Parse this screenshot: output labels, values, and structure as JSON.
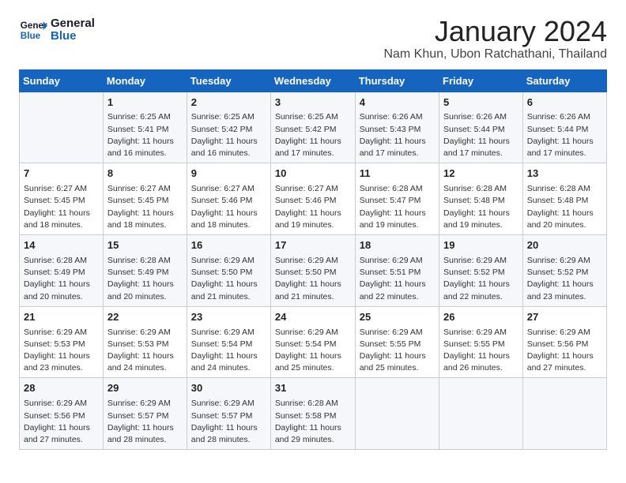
{
  "header": {
    "logo_general": "General",
    "logo_blue": "Blue",
    "month": "January 2024",
    "location": "Nam Khun, Ubon Ratchathani, Thailand"
  },
  "days_of_week": [
    "Sunday",
    "Monday",
    "Tuesday",
    "Wednesday",
    "Thursday",
    "Friday",
    "Saturday"
  ],
  "weeks": [
    [
      {
        "day": "",
        "sunrise": "",
        "sunset": "",
        "daylight": ""
      },
      {
        "day": "1",
        "sunrise": "Sunrise: 6:25 AM",
        "sunset": "Sunset: 5:41 PM",
        "daylight": "Daylight: 11 hours and 16 minutes."
      },
      {
        "day": "2",
        "sunrise": "Sunrise: 6:25 AM",
        "sunset": "Sunset: 5:42 PM",
        "daylight": "Daylight: 11 hours and 16 minutes."
      },
      {
        "day": "3",
        "sunrise": "Sunrise: 6:25 AM",
        "sunset": "Sunset: 5:42 PM",
        "daylight": "Daylight: 11 hours and 17 minutes."
      },
      {
        "day": "4",
        "sunrise": "Sunrise: 6:26 AM",
        "sunset": "Sunset: 5:43 PM",
        "daylight": "Daylight: 11 hours and 17 minutes."
      },
      {
        "day": "5",
        "sunrise": "Sunrise: 6:26 AM",
        "sunset": "Sunset: 5:44 PM",
        "daylight": "Daylight: 11 hours and 17 minutes."
      },
      {
        "day": "6",
        "sunrise": "Sunrise: 6:26 AM",
        "sunset": "Sunset: 5:44 PM",
        "daylight": "Daylight: 11 hours and 17 minutes."
      }
    ],
    [
      {
        "day": "7",
        "sunrise": "Sunrise: 6:27 AM",
        "sunset": "Sunset: 5:45 PM",
        "daylight": "Daylight: 11 hours and 18 minutes."
      },
      {
        "day": "8",
        "sunrise": "Sunrise: 6:27 AM",
        "sunset": "Sunset: 5:45 PM",
        "daylight": "Daylight: 11 hours and 18 minutes."
      },
      {
        "day": "9",
        "sunrise": "Sunrise: 6:27 AM",
        "sunset": "Sunset: 5:46 PM",
        "daylight": "Daylight: 11 hours and 18 minutes."
      },
      {
        "day": "10",
        "sunrise": "Sunrise: 6:27 AM",
        "sunset": "Sunset: 5:46 PM",
        "daylight": "Daylight: 11 hours and 19 minutes."
      },
      {
        "day": "11",
        "sunrise": "Sunrise: 6:28 AM",
        "sunset": "Sunset: 5:47 PM",
        "daylight": "Daylight: 11 hours and 19 minutes."
      },
      {
        "day": "12",
        "sunrise": "Sunrise: 6:28 AM",
        "sunset": "Sunset: 5:48 PM",
        "daylight": "Daylight: 11 hours and 19 minutes."
      },
      {
        "day": "13",
        "sunrise": "Sunrise: 6:28 AM",
        "sunset": "Sunset: 5:48 PM",
        "daylight": "Daylight: 11 hours and 20 minutes."
      }
    ],
    [
      {
        "day": "14",
        "sunrise": "Sunrise: 6:28 AM",
        "sunset": "Sunset: 5:49 PM",
        "daylight": "Daylight: 11 hours and 20 minutes."
      },
      {
        "day": "15",
        "sunrise": "Sunrise: 6:28 AM",
        "sunset": "Sunset: 5:49 PM",
        "daylight": "Daylight: 11 hours and 20 minutes."
      },
      {
        "day": "16",
        "sunrise": "Sunrise: 6:29 AM",
        "sunset": "Sunset: 5:50 PM",
        "daylight": "Daylight: 11 hours and 21 minutes."
      },
      {
        "day": "17",
        "sunrise": "Sunrise: 6:29 AM",
        "sunset": "Sunset: 5:50 PM",
        "daylight": "Daylight: 11 hours and 21 minutes."
      },
      {
        "day": "18",
        "sunrise": "Sunrise: 6:29 AM",
        "sunset": "Sunset: 5:51 PM",
        "daylight": "Daylight: 11 hours and 22 minutes."
      },
      {
        "day": "19",
        "sunrise": "Sunrise: 6:29 AM",
        "sunset": "Sunset: 5:52 PM",
        "daylight": "Daylight: 11 hours and 22 minutes."
      },
      {
        "day": "20",
        "sunrise": "Sunrise: 6:29 AM",
        "sunset": "Sunset: 5:52 PM",
        "daylight": "Daylight: 11 hours and 23 minutes."
      }
    ],
    [
      {
        "day": "21",
        "sunrise": "Sunrise: 6:29 AM",
        "sunset": "Sunset: 5:53 PM",
        "daylight": "Daylight: 11 hours and 23 minutes."
      },
      {
        "day": "22",
        "sunrise": "Sunrise: 6:29 AM",
        "sunset": "Sunset: 5:53 PM",
        "daylight": "Daylight: 11 hours and 24 minutes."
      },
      {
        "day": "23",
        "sunrise": "Sunrise: 6:29 AM",
        "sunset": "Sunset: 5:54 PM",
        "daylight": "Daylight: 11 hours and 24 minutes."
      },
      {
        "day": "24",
        "sunrise": "Sunrise: 6:29 AM",
        "sunset": "Sunset: 5:54 PM",
        "daylight": "Daylight: 11 hours and 25 minutes."
      },
      {
        "day": "25",
        "sunrise": "Sunrise: 6:29 AM",
        "sunset": "Sunset: 5:55 PM",
        "daylight": "Daylight: 11 hours and 25 minutes."
      },
      {
        "day": "26",
        "sunrise": "Sunrise: 6:29 AM",
        "sunset": "Sunset: 5:55 PM",
        "daylight": "Daylight: 11 hours and 26 minutes."
      },
      {
        "day": "27",
        "sunrise": "Sunrise: 6:29 AM",
        "sunset": "Sunset: 5:56 PM",
        "daylight": "Daylight: 11 hours and 27 minutes."
      }
    ],
    [
      {
        "day": "28",
        "sunrise": "Sunrise: 6:29 AM",
        "sunset": "Sunset: 5:56 PM",
        "daylight": "Daylight: 11 hours and 27 minutes."
      },
      {
        "day": "29",
        "sunrise": "Sunrise: 6:29 AM",
        "sunset": "Sunset: 5:57 PM",
        "daylight": "Daylight: 11 hours and 28 minutes."
      },
      {
        "day": "30",
        "sunrise": "Sunrise: 6:29 AM",
        "sunset": "Sunset: 5:57 PM",
        "daylight": "Daylight: 11 hours and 28 minutes."
      },
      {
        "day": "31",
        "sunrise": "Sunrise: 6:28 AM",
        "sunset": "Sunset: 5:58 PM",
        "daylight": "Daylight: 11 hours and 29 minutes."
      },
      {
        "day": "",
        "sunrise": "",
        "sunset": "",
        "daylight": ""
      },
      {
        "day": "",
        "sunrise": "",
        "sunset": "",
        "daylight": ""
      },
      {
        "day": "",
        "sunrise": "",
        "sunset": "",
        "daylight": ""
      }
    ]
  ]
}
